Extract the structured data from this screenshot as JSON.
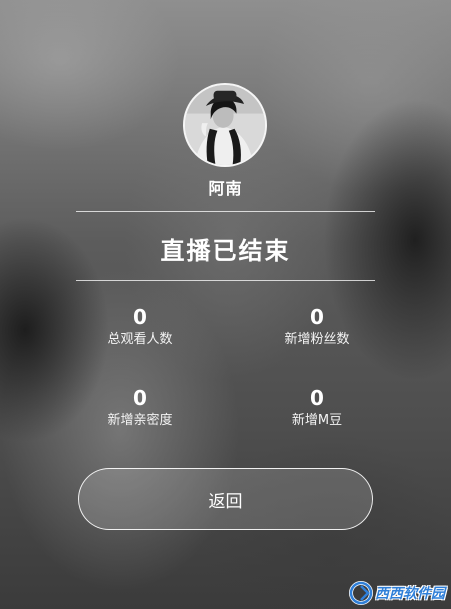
{
  "profile": {
    "name": "阿南"
  },
  "status": {
    "title": "直播已结束"
  },
  "stats": [
    {
      "value": "0",
      "label": "总观看人数"
    },
    {
      "value": "0",
      "label": "新增粉丝数"
    },
    {
      "value": "0",
      "label": "新增亲密度"
    },
    {
      "value": "0",
      "label": "新增M豆"
    }
  ],
  "actions": {
    "back_label": "返回"
  },
  "watermark": {
    "text": "西西软件园"
  },
  "colors": {
    "watermark_blue": "#2f7fd8",
    "text": "#ffffff"
  }
}
